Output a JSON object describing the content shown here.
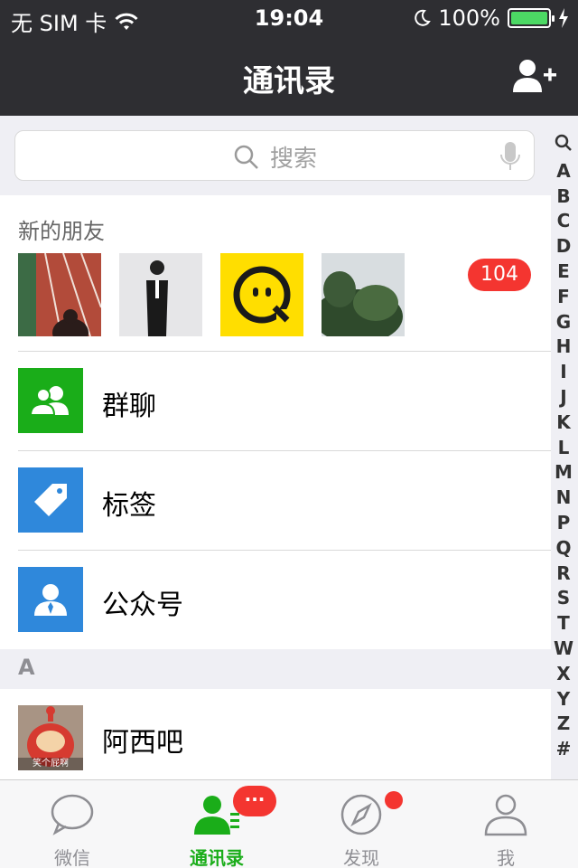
{
  "status": {
    "carrier": "无 SIM 卡",
    "time": "19:04",
    "battery": "100%",
    "battery_level": 1.0
  },
  "nav": {
    "title": "通讯录",
    "add_icon": "add-contact-icon"
  },
  "search": {
    "placeholder": "搜索"
  },
  "index": [
    "🔍",
    "A",
    "B",
    "C",
    "D",
    "E",
    "F",
    "G",
    "H",
    "I",
    "J",
    "K",
    "L",
    "M",
    "N",
    "P",
    "Q",
    "R",
    "S",
    "T",
    "W",
    "X",
    "Y",
    "Z",
    "#"
  ],
  "new_friends": {
    "label": "新的朋友",
    "badge": "104"
  },
  "rows": {
    "group_chat": "群聊",
    "tags": "标签",
    "official_accounts": "公众号"
  },
  "section": {
    "letter": "A"
  },
  "contacts": [
    {
      "name": "阿西吧",
      "avatar_caption": "笑个屁啊"
    }
  ],
  "tabs": [
    {
      "label": "微信",
      "icon": "chat-icon"
    },
    {
      "label": "通讯录",
      "icon": "contacts-icon",
      "bubble": "···"
    },
    {
      "label": "发现",
      "icon": "compass-icon"
    },
    {
      "label": "我",
      "icon": "profile-icon"
    }
  ],
  "colors": {
    "nav_bg": "#2e2e32",
    "accent_green": "#1aad19",
    "badge_red": "#f43530",
    "tag_blue": "#2f88db"
  }
}
